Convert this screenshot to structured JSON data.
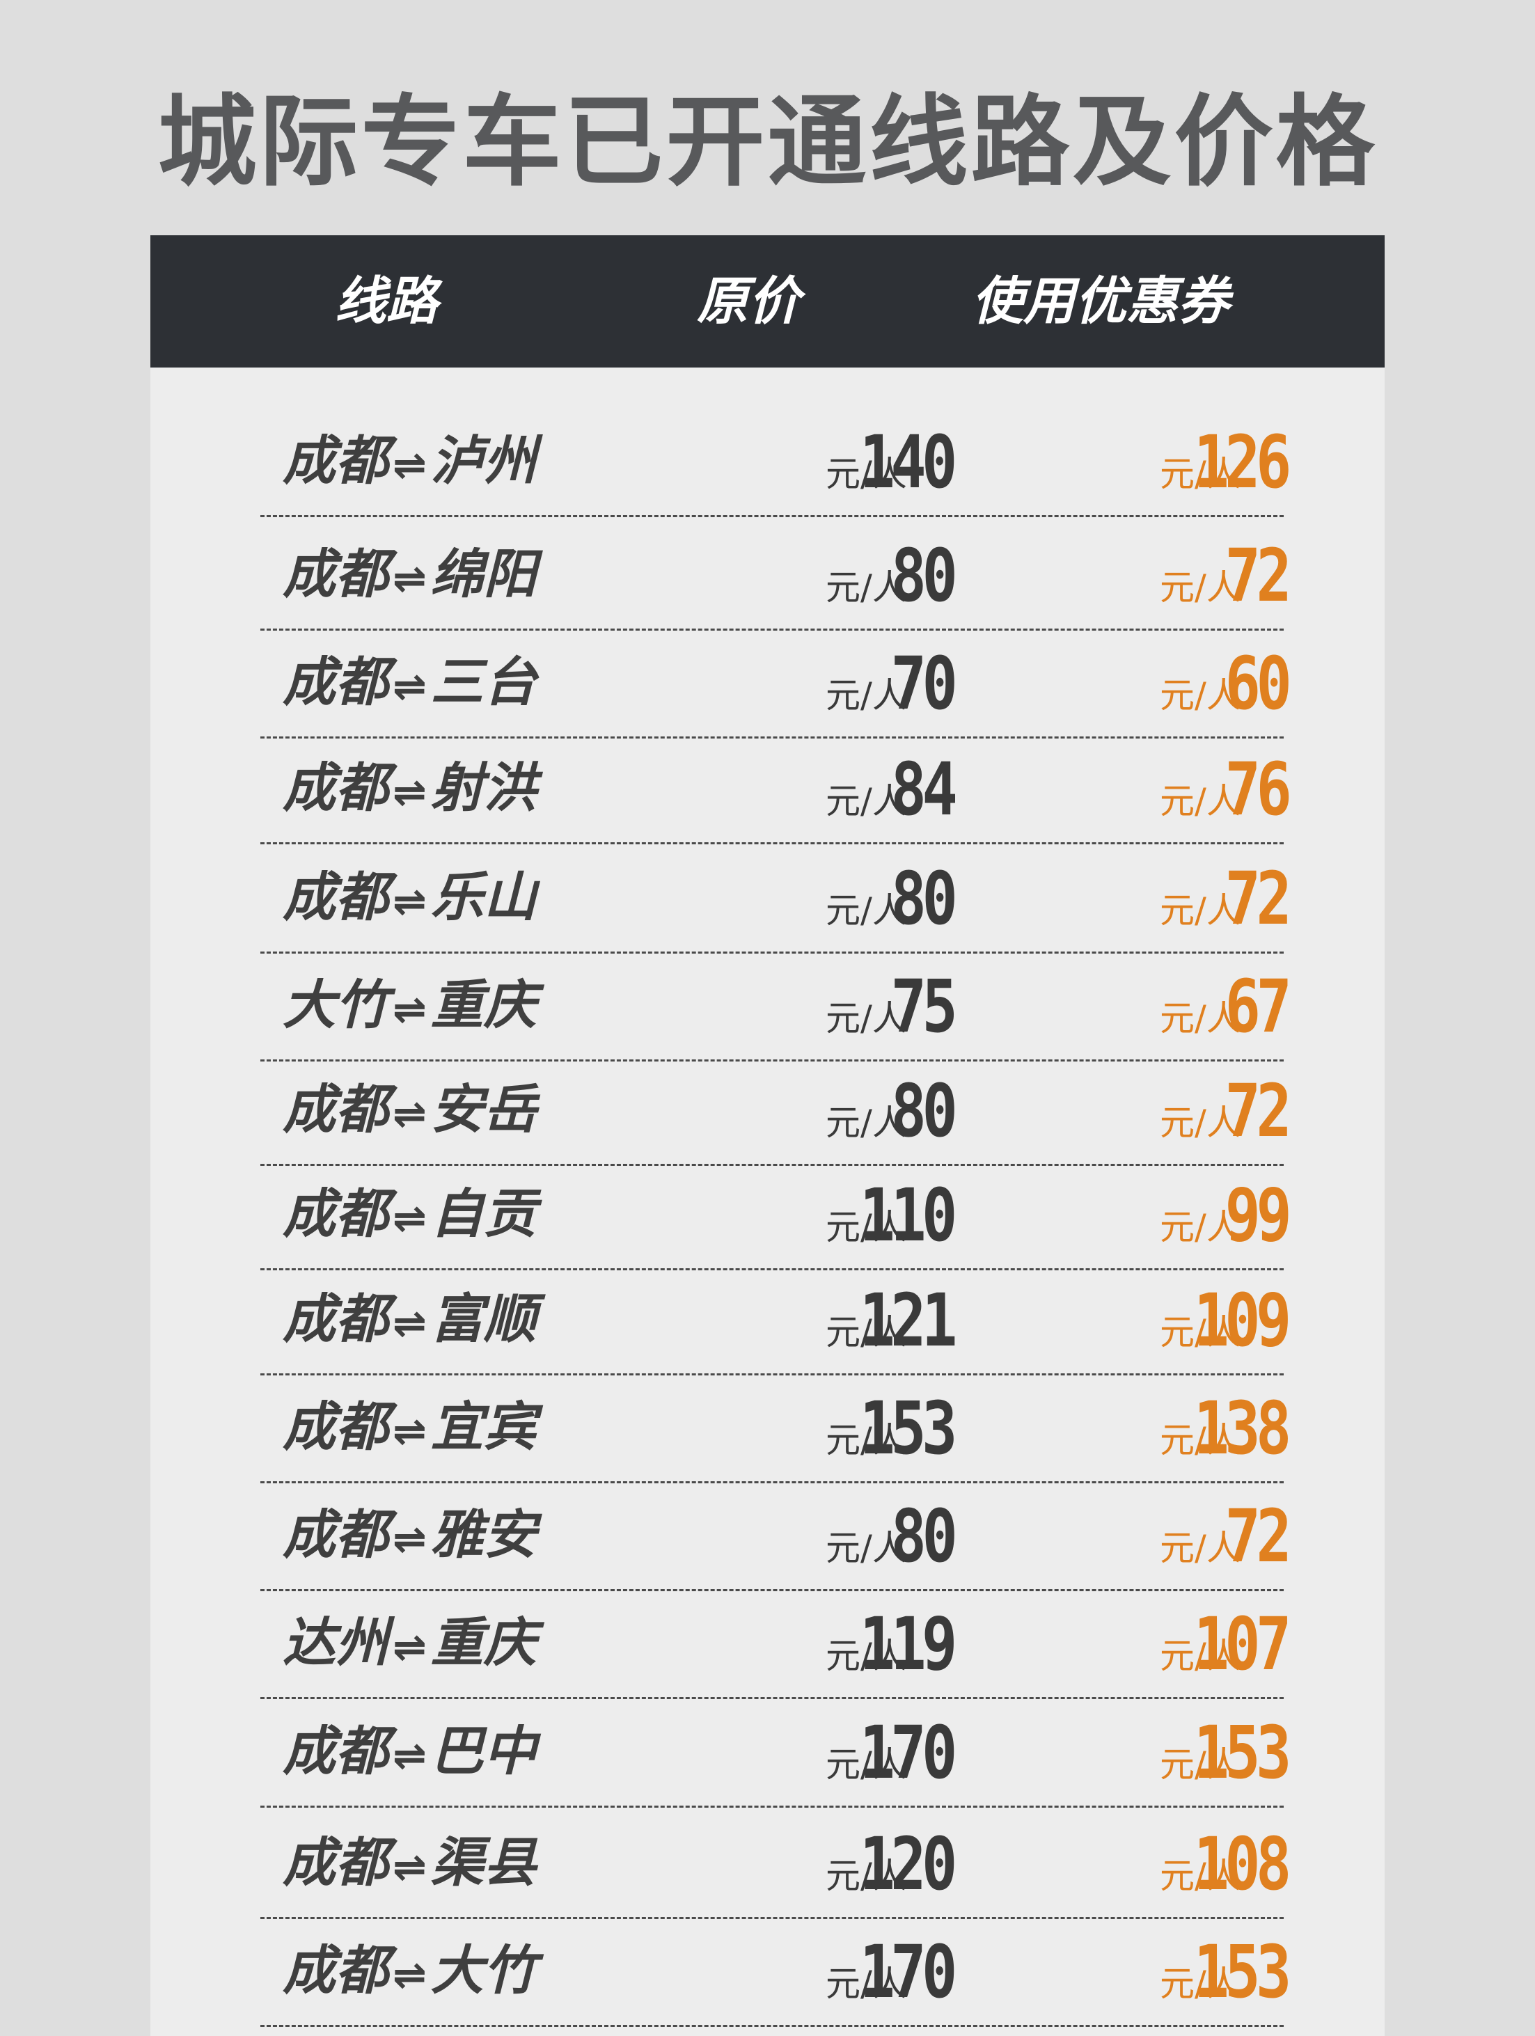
{
  "title": "城际专车已开通线路及价格",
  "header": {
    "route": "线路",
    "original_price": "原价",
    "coupon_price": "使用优惠券"
  },
  "arrow_symbol": "⇌",
  "unit": "元/人",
  "colors": {
    "header_bg": "#2d3035",
    "discount": "#e0801f",
    "text": "#3a3a3a"
  },
  "routes": [
    {
      "from": "成都",
      "to": "泸州",
      "original": "140",
      "discount": "126"
    },
    {
      "from": "成都",
      "to": "绵阳",
      "original": "80",
      "discount": "72"
    },
    {
      "from": "成都",
      "to": "三台",
      "original": "70",
      "discount": "60"
    },
    {
      "from": "成都",
      "to": "射洪",
      "original": "84",
      "discount": "76"
    },
    {
      "from": "成都",
      "to": "乐山",
      "original": "80",
      "discount": "72"
    },
    {
      "from": "大竹",
      "to": "重庆",
      "original": "75",
      "discount": "67"
    },
    {
      "from": "成都",
      "to": "安岳",
      "original": "80",
      "discount": "72"
    },
    {
      "from": "成都",
      "to": "自贡",
      "original": "110",
      "discount": "99"
    },
    {
      "from": "成都",
      "to": "富顺",
      "original": "121",
      "discount": "109"
    },
    {
      "from": "成都",
      "to": "宜宾",
      "original": "153",
      "discount": "138"
    },
    {
      "from": "成都",
      "to": "雅安",
      "original": "80",
      "discount": "72"
    },
    {
      "from": "达州",
      "to": "重庆",
      "original": "119",
      "discount": "107"
    },
    {
      "from": "成都",
      "to": "巴中",
      "original": "170",
      "discount": "153"
    },
    {
      "from": "成都",
      "to": "渠县",
      "original": "120",
      "discount": "108"
    },
    {
      "from": "成都",
      "to": "大竹",
      "original": "170",
      "discount": "153"
    }
  ]
}
